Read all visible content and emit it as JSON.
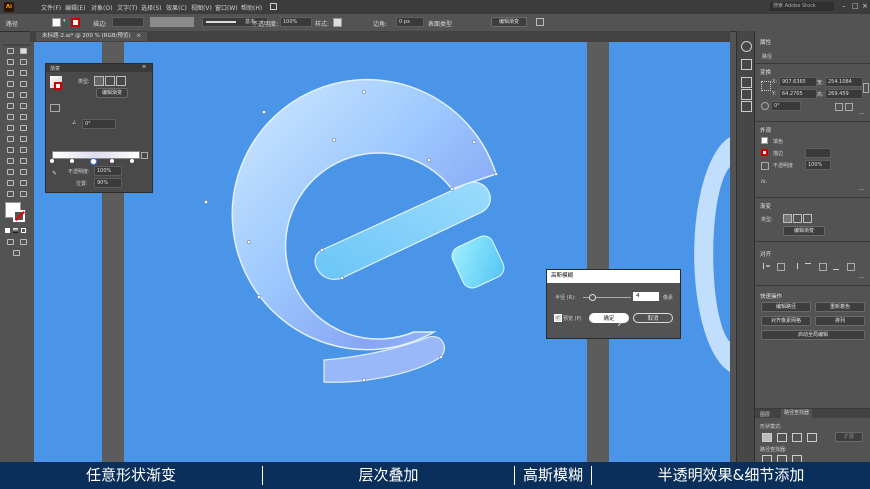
{
  "app": {
    "logo": "Ai"
  },
  "menu": [
    "文件(F)",
    "编辑(E)",
    "对象(O)",
    "文字(T)",
    "选择(S)",
    "效果(C)",
    "视图(V)",
    "窗口(W)",
    "帮助(H)"
  ],
  "window_search": "搜索 Adobe Stock",
  "control_bar": {
    "left_label": "路径",
    "stroke_label": "描边:",
    "stroke_style": "基本",
    "opacity_label": "不透明度:",
    "opacity_value": "100%",
    "style_label": "样式:",
    "corner_label": "边角:",
    "corner_value": "0 px",
    "shape_type_label": "表面类型",
    "edit_gradient_button": "编辑渐变"
  },
  "document_tab": "未标题-2.ai* @ 200 % (RGB/预览)",
  "gradient_panel": {
    "title": "渐变",
    "type_label": "类型:",
    "edit_button": "编辑渐变",
    "angle_value": "0°",
    "opacity_label": "不透明度:",
    "opacity_value": "100%",
    "location_label": "位置:",
    "location_value": "90%"
  },
  "gaussian_dialog": {
    "title": "高斯模糊",
    "radius_label": "半径 (R):",
    "radius_value": "4",
    "radius_unit": "像素",
    "preview_label": "预览 (P)",
    "ok_button": "确定",
    "cancel_button": "取消"
  },
  "properties_panel": {
    "tab": "属性",
    "section_path": "路径",
    "transform_title": "变换",
    "x_label": "X:",
    "x_value": "907.6365",
    "y_label": "Y:",
    "y_value": "64.2705",
    "w_label": "宽:",
    "w_value": "254.1084",
    "h_label": "高:",
    "h_value": "269.459",
    "angle_value": "0°",
    "appearance_title": "外观",
    "fill_label": "填色",
    "stroke_label": "描边",
    "opacity_label": "不透明度",
    "opacity_value": "100%",
    "fx_label": "fx.",
    "gradient_title": "渐变",
    "gradient_type_label": "类型:",
    "gradient_edit_button": "编辑渐变",
    "align_title": "对齐",
    "quick_actions_title": "快速操作",
    "quick_actions": [
      "编辑路径",
      "重新着色",
      "对齐像素网格",
      "排列",
      "启动全局编辑"
    ],
    "bottom_tabs": [
      "图层",
      "路径查找器"
    ],
    "shape_modes_label": "形状模式:",
    "expand_button": "扩展",
    "pathfinder_label": "路径查找器:"
  },
  "banner": [
    "任意形状渐变",
    "层次叠加",
    "高斯模糊",
    "半透明效果&细节添加"
  ],
  "colors": {
    "canvas_blue": "#4a95e8",
    "banner_navy": "#0a2f5a",
    "ui_gray": "#535353"
  }
}
